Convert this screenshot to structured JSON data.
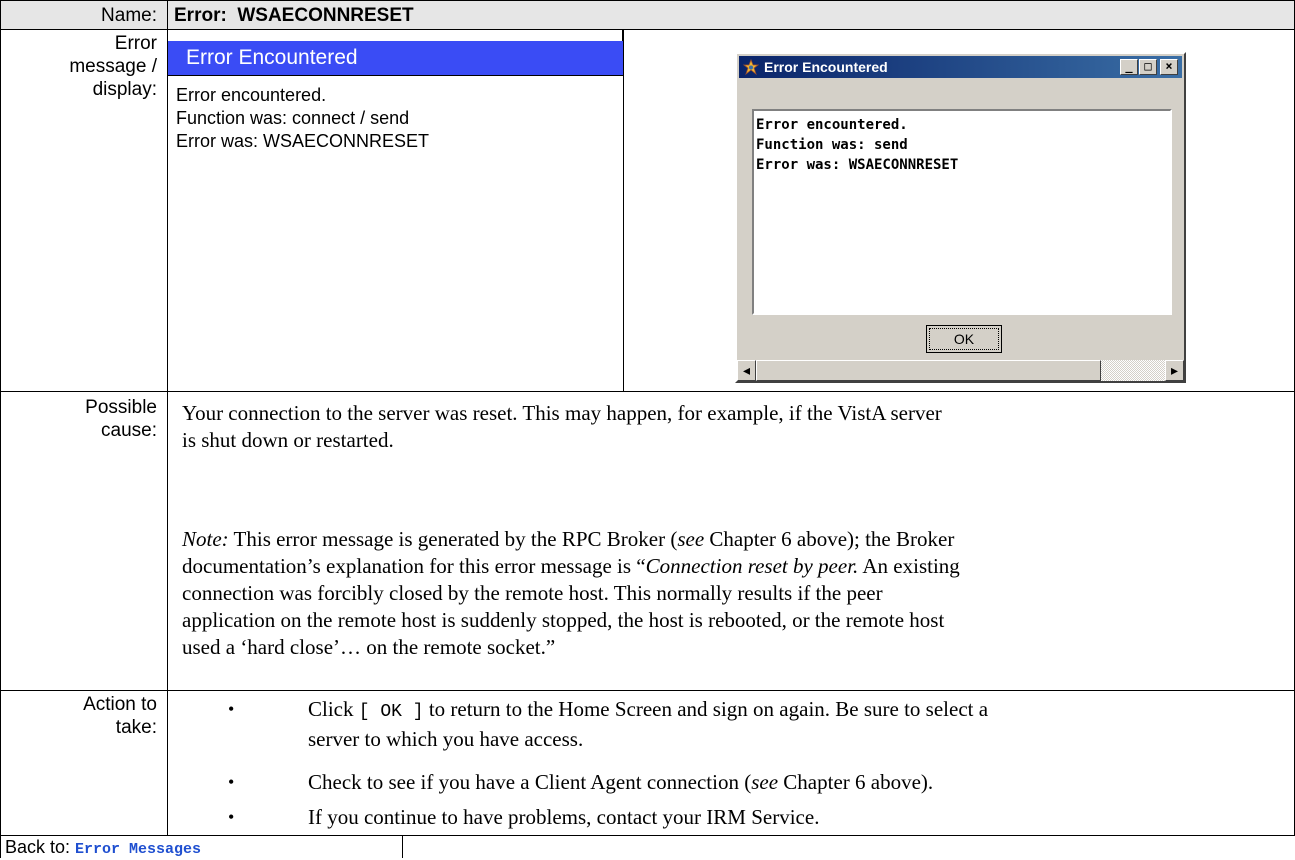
{
  "header": {
    "name_label": "Name:",
    "name_value": "Error:  WSAECONNRESET"
  },
  "error_row": {
    "label_lines": [
      "Error",
      "message /",
      "display:"
    ],
    "emulated": {
      "title": "Error Encountered",
      "lines": [
        "Error encountered.",
        "Function was: connect / send",
        "Error was: WSAECONNRESET"
      ]
    },
    "dialog": {
      "title": "Error Encountered",
      "lines": [
        "Error encountered.",
        "Function was: send",
        "Error was: WSAECONNRESET"
      ],
      "ok_label": "OK",
      "minimize_glyph": "_",
      "maximize_glyph": "□",
      "close_glyph": "×",
      "scroll_left_glyph": "◂",
      "scroll_right_glyph": "▸"
    }
  },
  "cause_row": {
    "label_lines": [
      "Possible",
      "cause:"
    ],
    "para1": [
      "Your connection to the server was reset. This may happen, for example, if the VistA server",
      "is shut down or restarted."
    ],
    "note_label": "Note:",
    "note_t1": " This error message is generated by the RPC Broker (",
    "note_see": "see",
    "note_t2": " Chapter 6 above); the Broker",
    "note_lines": [
      "documentation’s explanation for this error message is “",
      "connection was forcibly closed by the remote host. This normally results if the peer",
      "application on the remote host is suddenly stopped, the host is rebooted, or the remote host",
      "used a ‘hard close’… on the remote socket.”"
    ],
    "note_italic": "Connection reset by peer.",
    "note_line2_tail": " An existing"
  },
  "action_row": {
    "label_lines": [
      "Action to",
      "take:"
    ],
    "bullet_glyph": "•",
    "b1_pre": "Click ",
    "b1_code": "[ OK ]",
    "b1_post": " to return to the Home Screen and sign on again.  Be sure to select a",
    "b1_line2": "server to which you have access.",
    "b2_pre": "Check to see if you have a Client Agent connection (",
    "b2_see": "see",
    "b2_post": " Chapter 6 above).",
    "b3": "If you continue to have problems, contact your IRM Service."
  },
  "footer": {
    "back_label": "Back to: ",
    "back_link": "Error Messages"
  },
  "colors": {
    "panel_title_bg": "#3a4cf5",
    "header_bg": "#e6e6e6",
    "link": "#1f4fd0"
  }
}
